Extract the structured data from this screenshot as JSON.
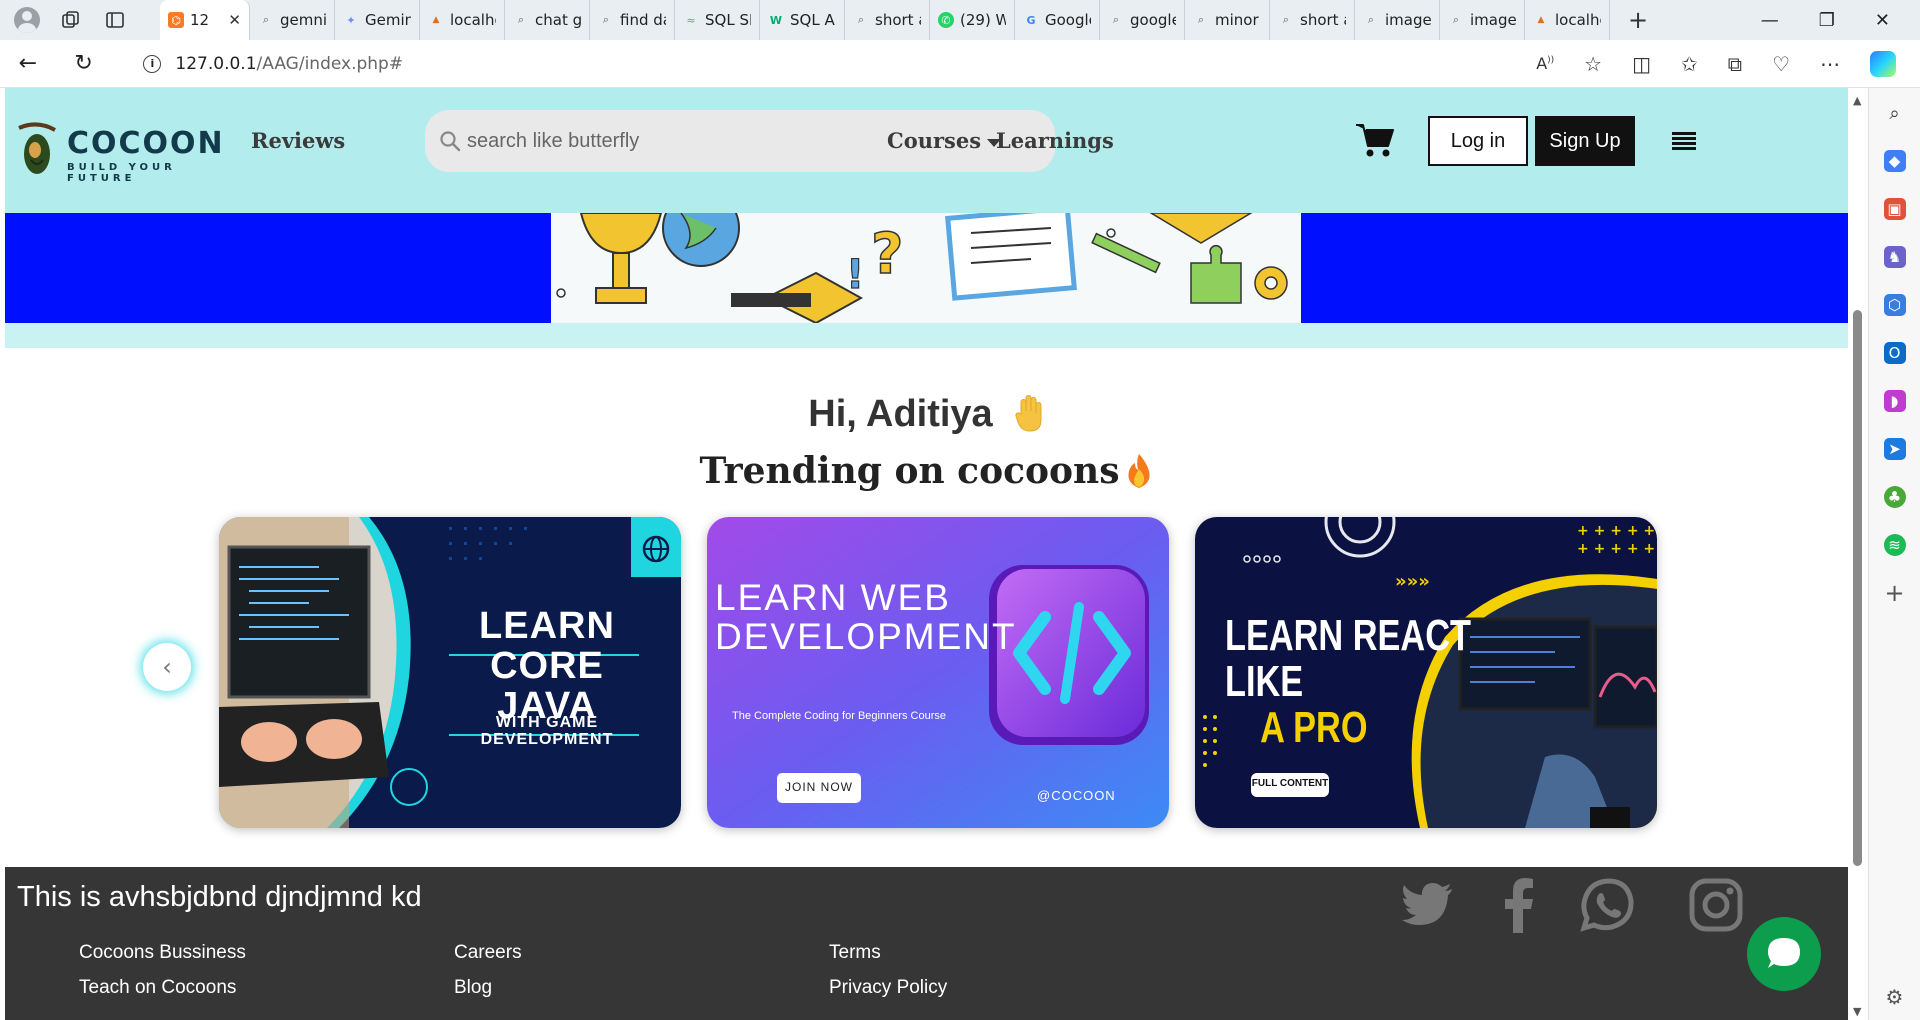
{
  "browser": {
    "tabs": [
      {
        "label": "12",
        "favicon": "xampp",
        "active": true
      },
      {
        "label": "gemni",
        "favicon": "search"
      },
      {
        "label": "Gemini",
        "favicon": "gemini"
      },
      {
        "label": "localho",
        "favicon": "pma"
      },
      {
        "label": "chat gp",
        "favicon": "search"
      },
      {
        "label": "find da",
        "favicon": "search"
      },
      {
        "label": "SQL SE",
        "favicon": "sql"
      },
      {
        "label": "SQL AL",
        "favicon": "w3"
      },
      {
        "label": "short a",
        "favicon": "search"
      },
      {
        "label": "(29) W",
        "favicon": "whatsapp"
      },
      {
        "label": "Google",
        "favicon": "google"
      },
      {
        "label": "google",
        "favicon": "search"
      },
      {
        "label": "minor",
        "favicon": "search"
      },
      {
        "label": "short a",
        "favicon": "search"
      },
      {
        "label": "image",
        "favicon": "search"
      },
      {
        "label": "image",
        "favicon": "search"
      },
      {
        "label": "localho",
        "favicon": "pma"
      }
    ],
    "url_host": "127.0.0.1",
    "url_path": "/AAG/index.php#"
  },
  "site": {
    "logo_word": "COCOON",
    "logo_tagline": "BUILD YOUR FUTURE",
    "nav": {
      "reviews": "Reviews",
      "courses": "Courses",
      "learnings": "Learnings",
      "login": "Log in",
      "signup": "Sign Up"
    },
    "search_placeholder": "search like butterfly",
    "greeting": "Hi, Aditiya",
    "trending": "Trending on cocoons",
    "cards": [
      {
        "line1": "LEARN",
        "line2": "CORE JAVA",
        "sub1": "WITH GAME",
        "sub2": "DEVELOPMENT"
      },
      {
        "line1": "LEARN WEB",
        "line2": "DEVELOPMENT",
        "sub": "The Complete Coding for Beginners Course",
        "cta": "JOIN NOW",
        "handle": "@COCOON"
      },
      {
        "line1": "LEARN REACT",
        "line2": "LIKE",
        "line3": "A PRO",
        "cta": "FULL CONTENT"
      }
    ],
    "footer": {
      "title": "This is avhsbjdbnd djndjmnd kd",
      "links": [
        "Cocoons Bussiness",
        "Careers",
        "Terms",
        "Teach on Cocoons",
        "Blog",
        "Privacy Policy"
      ]
    }
  },
  "colors": {
    "nav_bg": "#b3ecec",
    "banner_blue": "#0010ff",
    "footer_bg": "#363636",
    "chat_green": "#0d9e4d"
  }
}
